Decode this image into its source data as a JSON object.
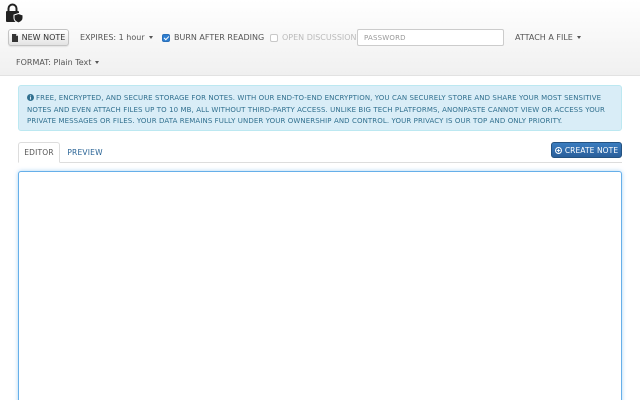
{
  "toolbar": {
    "new_note_label": "NEW NOTE",
    "expires_label": "EXPIRES: 1 hour",
    "burn_label": "BURN AFTER READING",
    "burn_checked": true,
    "discussion_label": "OPEN DISCUSSION",
    "discussion_checked": false,
    "password_placeholder": "PASSWORD",
    "attach_label": "ATTACH A FILE",
    "format_label": "FORMAT: Plain Text"
  },
  "alert": {
    "text": "FREE, ENCRYPTED, AND SECURE STORAGE FOR NOTES. WITH OUR END-TO-END ENCRYPTION, YOU CAN SECURELY STORE AND SHARE YOUR MOST SENSITIVE NOTES AND EVEN ATTACH FILES UP TO 10 MB, ALL WITHOUT THIRD-PARTY ACCESS. UNLIKE BIG TECH PLATFORMS, ANONPASTE CANNOT VIEW OR ACCESS YOUR PRIVATE MESSAGES OR FILES. YOUR DATA REMAINS FULLY UNDER YOUR OWNERSHIP AND CONTROL. YOUR PRIVACY IS OUR TOP AND ONLY PRIORITY."
  },
  "tabs": [
    {
      "label": "EDITOR",
      "active": true
    },
    {
      "label": "PREVIEW",
      "active": false
    }
  ],
  "create_label": "CREATE NOTE",
  "editor": {
    "value": ""
  },
  "icons": {
    "logo": "lock-shield-icon",
    "new_note": "document-icon",
    "alert": "info-circle-icon",
    "create": "plus-circle-icon"
  },
  "colors": {
    "primary": "#2a5f9a",
    "alert_bg": "#d9edf7",
    "alert_text": "#31708f",
    "link": "#2a6496",
    "checkbox": "#2f7fd1"
  }
}
